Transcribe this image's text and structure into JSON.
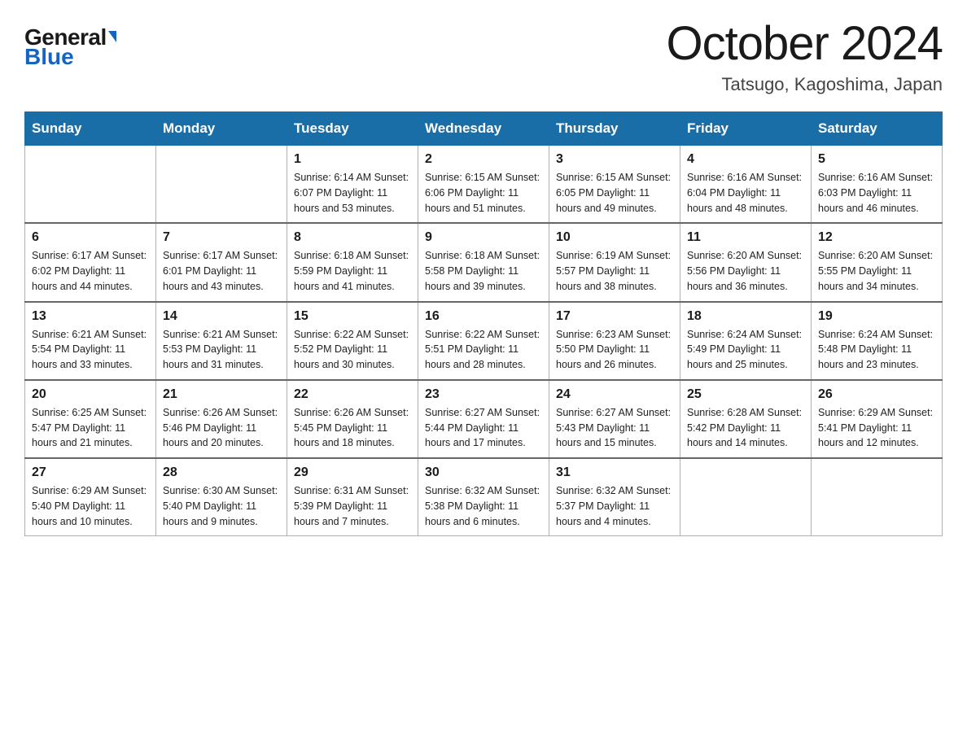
{
  "logo": {
    "general": "General",
    "blue": "Blue"
  },
  "title": "October 2024",
  "subtitle": "Tatsugo, Kagoshima, Japan",
  "days_of_week": [
    "Sunday",
    "Monday",
    "Tuesday",
    "Wednesday",
    "Thursday",
    "Friday",
    "Saturday"
  ],
  "weeks": [
    [
      {
        "day": "",
        "info": ""
      },
      {
        "day": "",
        "info": ""
      },
      {
        "day": "1",
        "info": "Sunrise: 6:14 AM\nSunset: 6:07 PM\nDaylight: 11 hours\nand 53 minutes."
      },
      {
        "day": "2",
        "info": "Sunrise: 6:15 AM\nSunset: 6:06 PM\nDaylight: 11 hours\nand 51 minutes."
      },
      {
        "day": "3",
        "info": "Sunrise: 6:15 AM\nSunset: 6:05 PM\nDaylight: 11 hours\nand 49 minutes."
      },
      {
        "day": "4",
        "info": "Sunrise: 6:16 AM\nSunset: 6:04 PM\nDaylight: 11 hours\nand 48 minutes."
      },
      {
        "day": "5",
        "info": "Sunrise: 6:16 AM\nSunset: 6:03 PM\nDaylight: 11 hours\nand 46 minutes."
      }
    ],
    [
      {
        "day": "6",
        "info": "Sunrise: 6:17 AM\nSunset: 6:02 PM\nDaylight: 11 hours\nand 44 minutes."
      },
      {
        "day": "7",
        "info": "Sunrise: 6:17 AM\nSunset: 6:01 PM\nDaylight: 11 hours\nand 43 minutes."
      },
      {
        "day": "8",
        "info": "Sunrise: 6:18 AM\nSunset: 5:59 PM\nDaylight: 11 hours\nand 41 minutes."
      },
      {
        "day": "9",
        "info": "Sunrise: 6:18 AM\nSunset: 5:58 PM\nDaylight: 11 hours\nand 39 minutes."
      },
      {
        "day": "10",
        "info": "Sunrise: 6:19 AM\nSunset: 5:57 PM\nDaylight: 11 hours\nand 38 minutes."
      },
      {
        "day": "11",
        "info": "Sunrise: 6:20 AM\nSunset: 5:56 PM\nDaylight: 11 hours\nand 36 minutes."
      },
      {
        "day": "12",
        "info": "Sunrise: 6:20 AM\nSunset: 5:55 PM\nDaylight: 11 hours\nand 34 minutes."
      }
    ],
    [
      {
        "day": "13",
        "info": "Sunrise: 6:21 AM\nSunset: 5:54 PM\nDaylight: 11 hours\nand 33 minutes."
      },
      {
        "day": "14",
        "info": "Sunrise: 6:21 AM\nSunset: 5:53 PM\nDaylight: 11 hours\nand 31 minutes."
      },
      {
        "day": "15",
        "info": "Sunrise: 6:22 AM\nSunset: 5:52 PM\nDaylight: 11 hours\nand 30 minutes."
      },
      {
        "day": "16",
        "info": "Sunrise: 6:22 AM\nSunset: 5:51 PM\nDaylight: 11 hours\nand 28 minutes."
      },
      {
        "day": "17",
        "info": "Sunrise: 6:23 AM\nSunset: 5:50 PM\nDaylight: 11 hours\nand 26 minutes."
      },
      {
        "day": "18",
        "info": "Sunrise: 6:24 AM\nSunset: 5:49 PM\nDaylight: 11 hours\nand 25 minutes."
      },
      {
        "day": "19",
        "info": "Sunrise: 6:24 AM\nSunset: 5:48 PM\nDaylight: 11 hours\nand 23 minutes."
      }
    ],
    [
      {
        "day": "20",
        "info": "Sunrise: 6:25 AM\nSunset: 5:47 PM\nDaylight: 11 hours\nand 21 minutes."
      },
      {
        "day": "21",
        "info": "Sunrise: 6:26 AM\nSunset: 5:46 PM\nDaylight: 11 hours\nand 20 minutes."
      },
      {
        "day": "22",
        "info": "Sunrise: 6:26 AM\nSunset: 5:45 PM\nDaylight: 11 hours\nand 18 minutes."
      },
      {
        "day": "23",
        "info": "Sunrise: 6:27 AM\nSunset: 5:44 PM\nDaylight: 11 hours\nand 17 minutes."
      },
      {
        "day": "24",
        "info": "Sunrise: 6:27 AM\nSunset: 5:43 PM\nDaylight: 11 hours\nand 15 minutes."
      },
      {
        "day": "25",
        "info": "Sunrise: 6:28 AM\nSunset: 5:42 PM\nDaylight: 11 hours\nand 14 minutes."
      },
      {
        "day": "26",
        "info": "Sunrise: 6:29 AM\nSunset: 5:41 PM\nDaylight: 11 hours\nand 12 minutes."
      }
    ],
    [
      {
        "day": "27",
        "info": "Sunrise: 6:29 AM\nSunset: 5:40 PM\nDaylight: 11 hours\nand 10 minutes."
      },
      {
        "day": "28",
        "info": "Sunrise: 6:30 AM\nSunset: 5:40 PM\nDaylight: 11 hours\nand 9 minutes."
      },
      {
        "day": "29",
        "info": "Sunrise: 6:31 AM\nSunset: 5:39 PM\nDaylight: 11 hours\nand 7 minutes."
      },
      {
        "day": "30",
        "info": "Sunrise: 6:32 AM\nSunset: 5:38 PM\nDaylight: 11 hours\nand 6 minutes."
      },
      {
        "day": "31",
        "info": "Sunrise: 6:32 AM\nSunset: 5:37 PM\nDaylight: 11 hours\nand 4 minutes."
      },
      {
        "day": "",
        "info": ""
      },
      {
        "day": "",
        "info": ""
      }
    ]
  ]
}
